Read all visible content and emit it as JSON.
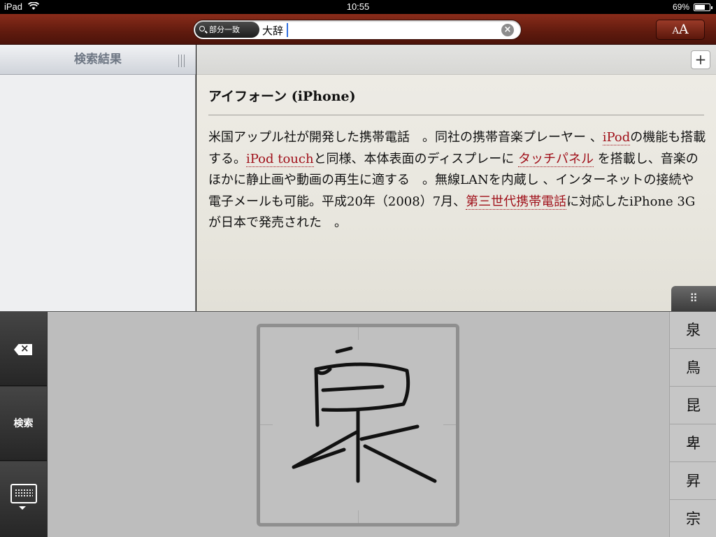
{
  "status_bar": {
    "device": "iPad",
    "time": "10:55",
    "battery_text": "69%",
    "battery_level": 0.69
  },
  "toolbar": {
    "scope_label": "部分一致",
    "search_value": "大辞",
    "clear_icon": "clear-icon",
    "font_small": "A",
    "font_big": "A"
  },
  "left_pane": {
    "title": "検索結果"
  },
  "entry": {
    "title": "アイフォーン (iPhone)",
    "body": [
      {
        "t": "米国アップル社が開発した携帯電話　。同社の携帯音楽プレーヤー 、",
        "link": false
      },
      {
        "t": "iPod",
        "link": true
      },
      {
        "t": "の機能も搭載する。",
        "link": false
      },
      {
        "t": "iPod touch",
        "link": true
      },
      {
        "t": "と同様、本体表面のディスプレーに ",
        "link": false
      },
      {
        "t": "タッチパネル",
        "link": true
      },
      {
        "t": " を搭載し、音楽のほかに静止画や動画の再生に適する　。無線LANを内蔵し 、インターネットの接続や電子メールも可能。平成20年（2008）7月、",
        "link": false
      },
      {
        "t": "第三世代携帯電話",
        "link": true
      },
      {
        "t": "に対応したiPhone 3Gが日本で発売された　。",
        "link": false
      }
    ],
    "plus_label": "+",
    "keyboard_toggle_label": "⠿"
  },
  "keyboard": {
    "search_key_label": "検索",
    "candidates": [
      "泉",
      "鳥",
      "昆",
      "卑",
      "昇",
      "宗"
    ],
    "colors": {
      "link": "#a0101a",
      "toolbar": "#6b1f10"
    }
  }
}
